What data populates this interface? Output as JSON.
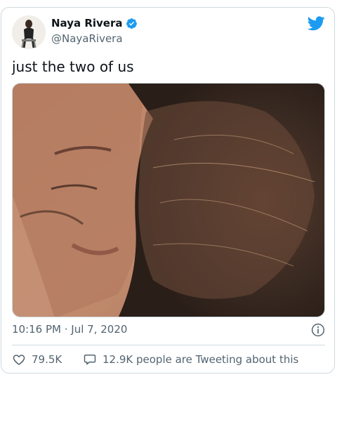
{
  "tweet": {
    "author_name": "Naya Rivera",
    "author_handle": "@NayaRivera",
    "text": "just the two of us",
    "timestamp": "10:16 PM · Jul 7, 2020",
    "likes": "79.5K",
    "replies_text": "12.9K people are Tweeting about this"
  },
  "icons": {
    "verified": "verified-badge-icon",
    "brand": "twitter-bird-icon",
    "info": "info-icon",
    "like": "heart-icon",
    "reply": "comment-bubble-icon"
  },
  "colors": {
    "brand_blue": "#1d9bf0",
    "text_primary": "#0f1419",
    "text_secondary": "#536471",
    "border": "#cfd9de"
  }
}
